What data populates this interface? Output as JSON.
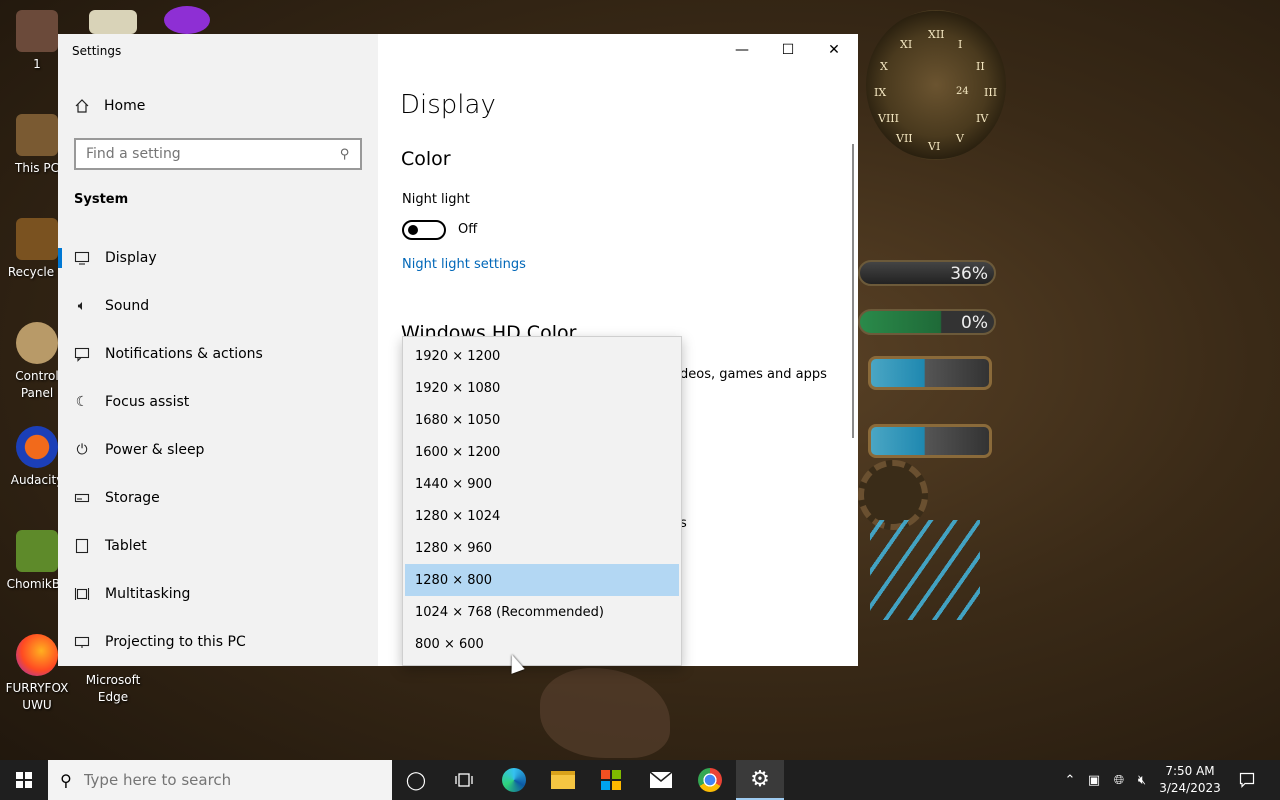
{
  "desktop": {
    "icons": [
      {
        "label": "1"
      },
      {
        "label": "This PC"
      },
      {
        "label": "Recycle B"
      },
      {
        "label": "Control Panel"
      },
      {
        "label": "Audacity"
      },
      {
        "label": "ChomikBo"
      },
      {
        "label": "FURRYFOX UWU"
      },
      {
        "label": "Microsoft Edge"
      }
    ]
  },
  "gadgets": {
    "cpu_percent": "36%",
    "ram_percent": "0%",
    "clock_numerals": [
      "XI",
      "XII",
      "I",
      "II",
      "III",
      "IV",
      "V",
      "VI",
      "VII",
      "VIII",
      "IX",
      "X"
    ],
    "clock_sub_dial": "24"
  },
  "window": {
    "title": "Settings",
    "controls": {
      "minimize": "—",
      "maximize": "☐",
      "close": "✕"
    }
  },
  "sidebar": {
    "home": "Home",
    "search_placeholder": "Find a setting",
    "section": "System",
    "items": [
      {
        "label": "Display",
        "icon": "monitor-icon"
      },
      {
        "label": "Sound",
        "icon": "speaker-icon"
      },
      {
        "label": "Notifications & actions",
        "icon": "message-icon"
      },
      {
        "label": "Focus assist",
        "icon": "moon-icon"
      },
      {
        "label": "Power & sleep",
        "icon": "power-icon"
      },
      {
        "label": "Storage",
        "icon": "storage-icon"
      },
      {
        "label": "Tablet",
        "icon": "tablet-icon"
      },
      {
        "label": "Multitasking",
        "icon": "multitasking-icon"
      },
      {
        "label": "Projecting to this PC",
        "icon": "projector-icon"
      }
    ]
  },
  "content": {
    "title": "Display",
    "color_heading": "Color",
    "night_light_label": "Night light",
    "night_light_state": "Off",
    "night_light_link": "Night light settings",
    "hd_heading": "Windows HD Color",
    "hd_partial_text": "deos, games and apps",
    "partial_s": "s"
  },
  "resolution_dropdown": {
    "options": [
      "1920 × 1200",
      "1920 × 1080",
      "1680 × 1050",
      "1600 × 1200",
      "1440 × 900",
      "1280 × 1024",
      "1280 × 960",
      "1280 × 800",
      "1024 × 768 (Recommended)",
      "800 × 600"
    ],
    "selected": "1280 × 800"
  },
  "taskbar": {
    "search_placeholder": "Type here to search",
    "time": "7:50 AM",
    "date": "3/24/2023"
  }
}
